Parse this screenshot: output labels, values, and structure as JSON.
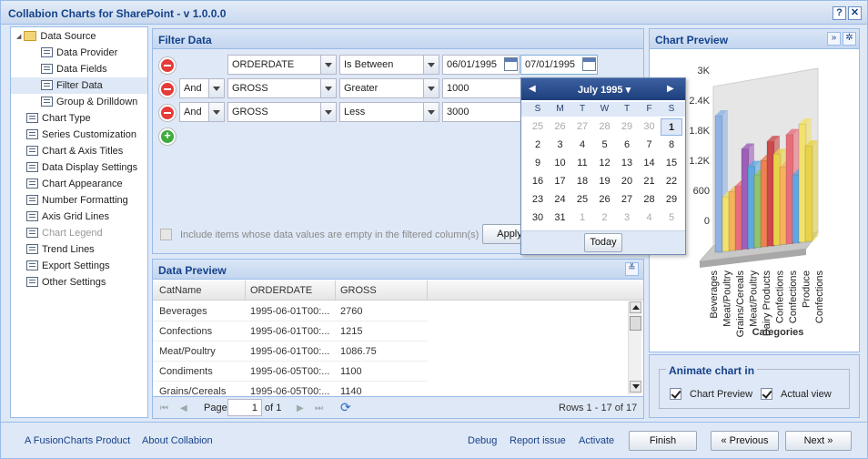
{
  "window": {
    "title": "Collabion Charts for SharePoint - v 1.0.0.0",
    "help_label": "?",
    "close_label": "✕"
  },
  "tree": {
    "items": [
      {
        "label": "Data Source",
        "kind": "folder",
        "level": 0
      },
      {
        "label": "Data Provider",
        "kind": "leaf",
        "level": 1
      },
      {
        "label": "Data Fields",
        "kind": "leaf",
        "level": 1
      },
      {
        "label": "Filter Data",
        "kind": "leaf",
        "level": 1,
        "selected": true
      },
      {
        "label": "Group & Drilldown",
        "kind": "leaf",
        "level": 1
      },
      {
        "label": "Chart Type",
        "kind": "leaf",
        "level": 0
      },
      {
        "label": "Series Customization",
        "kind": "leaf",
        "level": 0
      },
      {
        "label": "Chart & Axis Titles",
        "kind": "leaf",
        "level": 0
      },
      {
        "label": "Data Display Settings",
        "kind": "leaf",
        "level": 0
      },
      {
        "label": "Chart Appearance",
        "kind": "leaf",
        "level": 0
      },
      {
        "label": "Number Formatting",
        "kind": "leaf",
        "level": 0
      },
      {
        "label": "Axis Grid Lines",
        "kind": "leaf",
        "level": 0
      },
      {
        "label": "Chart Legend",
        "kind": "leaf",
        "level": 0,
        "disabled": true
      },
      {
        "label": "Trend Lines",
        "kind": "leaf",
        "level": 0
      },
      {
        "label": "Export Settings",
        "kind": "leaf",
        "level": 0
      },
      {
        "label": "Other Settings",
        "kind": "leaf",
        "level": 0
      }
    ]
  },
  "filter": {
    "title": "Filter Data",
    "rows": [
      {
        "join": "",
        "field": "ORDERDATE",
        "op": "Is Between",
        "value1": "06/01/1995",
        "value2": "07/01/1995"
      },
      {
        "join": "And",
        "field": "GROSS",
        "op": "Greater",
        "value1": "1000"
      },
      {
        "join": "And",
        "field": "GROSS",
        "op": "Less",
        "value1": "3000"
      }
    ],
    "include_empty_label": "Include items whose data values are empty in the filtered column(s)",
    "apply_label": "Apply"
  },
  "calendar": {
    "month_label": "July 1995",
    "dow": [
      "S",
      "M",
      "T",
      "W",
      "T",
      "F",
      "S"
    ],
    "weeks": [
      [
        "25",
        "26",
        "27",
        "28",
        "29",
        "30",
        "1"
      ],
      [
        "2",
        "3",
        "4",
        "5",
        "6",
        "7",
        "8"
      ],
      [
        "9",
        "10",
        "11",
        "12",
        "13",
        "14",
        "15"
      ],
      [
        "16",
        "17",
        "18",
        "19",
        "20",
        "21",
        "22"
      ],
      [
        "23",
        "24",
        "25",
        "26",
        "27",
        "28",
        "29"
      ],
      [
        "30",
        "31",
        "1",
        "2",
        "3",
        "4",
        "5"
      ]
    ],
    "today_label": "Today"
  },
  "preview": {
    "title": "Data Preview",
    "columns": [
      "CatName",
      "ORDERDATE",
      "GROSS"
    ],
    "rows": [
      [
        "Beverages",
        "1995-06-01T00:...",
        "2760"
      ],
      [
        "Confections",
        "1995-06-01T00:...",
        "1215"
      ],
      [
        "Meat/Poultry",
        "1995-06-01T00:...",
        "1086.75"
      ],
      [
        "Condiments",
        "1995-06-05T00:...",
        "1100"
      ],
      [
        "Grains/Cereals",
        "1995-06-05T00:...",
        "1140"
      ]
    ],
    "page_label": "Page",
    "page_value": "1",
    "of_label": "of 1",
    "rows_label": "Rows 1 - 17 of 17"
  },
  "chart_preview": {
    "title": "Chart Preview",
    "y_ticks": [
      "3K",
      "2.4K",
      "1.8K",
      "1.2K",
      "600",
      "0"
    ],
    "x_labels": [
      "Beverages",
      "Meat/Poultry",
      "Grains/Cereals",
      "Meat/Poultry",
      "Dairy Products",
      "Confections",
      "Confections",
      "Produce",
      "Confections"
    ],
    "x_axis_title": "Categories"
  },
  "chart_data": {
    "type": "bar",
    "ylim": [
      0,
      3000
    ],
    "colors": [
      "#f2e16a",
      "#f5b35c",
      "#e86e7a",
      "#9e5fb8",
      "#5fa7e0",
      "#90c46a",
      "#f08050",
      "#cc4a4a",
      "#e8d24a"
    ]
  },
  "animate": {
    "title": "Animate chart in",
    "chart_preview_label": "Chart Preview",
    "actual_view_label": "Actual view"
  },
  "footer": {
    "fusioncharts_link": "A FusionCharts Product",
    "about_link": "About Collabion",
    "debug_link": "Debug",
    "report_link": "Report issue",
    "activate_link": "Activate",
    "finish_label": "Finish",
    "previous_label": "« Previous",
    "next_label": "Next »"
  }
}
